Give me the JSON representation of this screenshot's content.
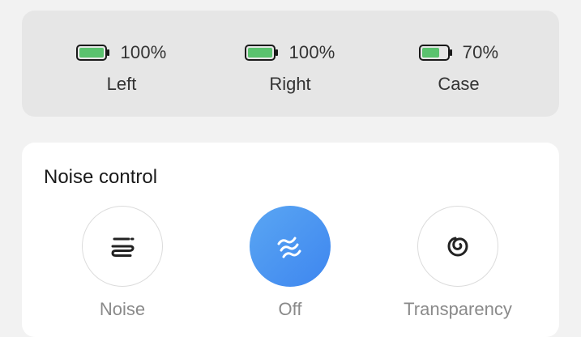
{
  "battery": {
    "items": [
      {
        "label": "Left",
        "percent_text": "100%",
        "level": 1.0
      },
      {
        "label": "Right",
        "percent_text": "100%",
        "level": 1.0
      },
      {
        "label": "Case",
        "percent_text": "70%",
        "level": 0.7
      }
    ],
    "fill_color": "#5ac26e"
  },
  "noise_control": {
    "title": "Noise control",
    "selected": "Off",
    "modes": [
      {
        "label": "Noise",
        "icon": "noise-cancel-icon",
        "active": false
      },
      {
        "label": "Off",
        "icon": "waves-icon",
        "active": true
      },
      {
        "label": "Transparency",
        "icon": "transparency-spiral-icon",
        "active": false
      }
    ],
    "active_color": "#4a90f0"
  }
}
